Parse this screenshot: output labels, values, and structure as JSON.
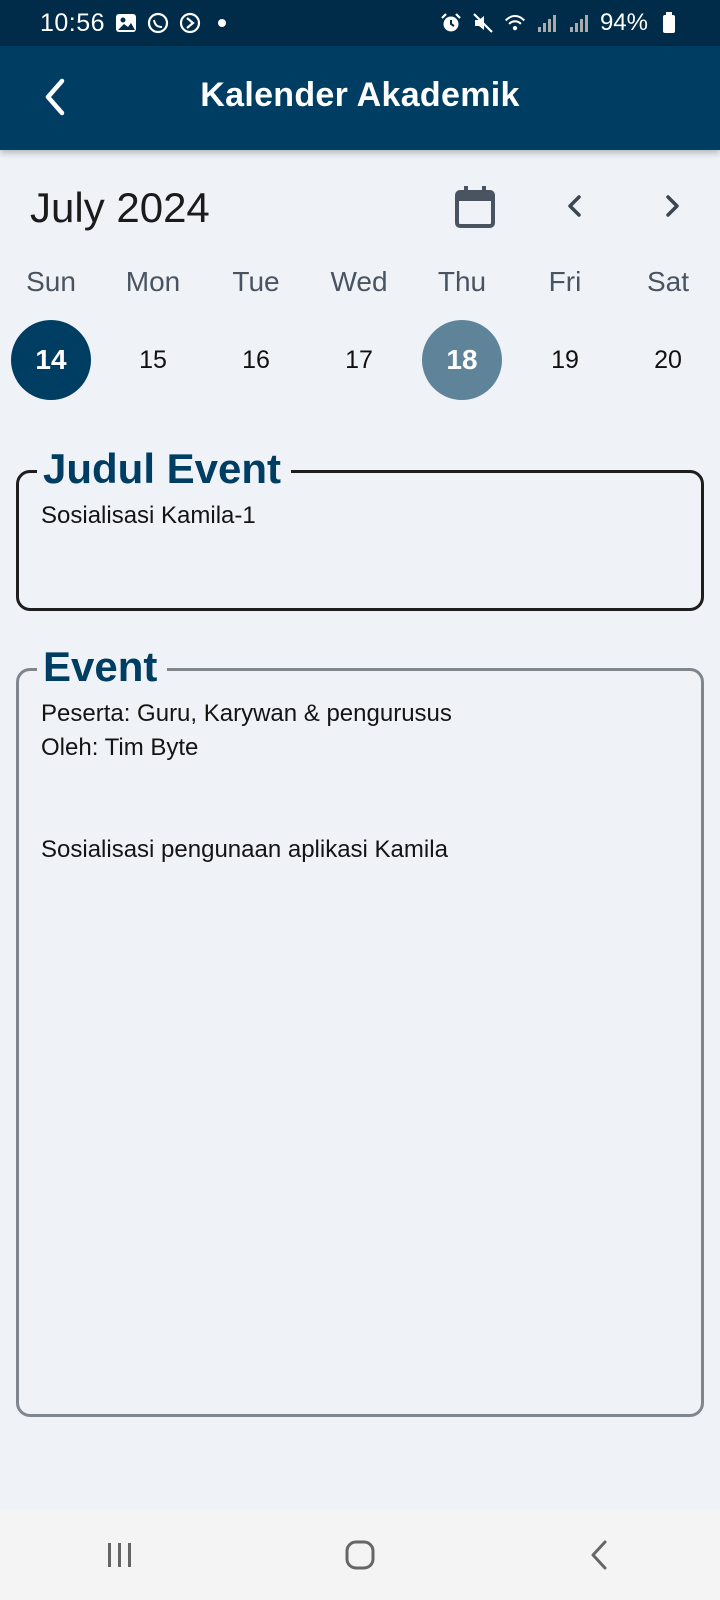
{
  "status_bar": {
    "time": "10:56",
    "battery": "94%",
    "icons_left": [
      "gallery-icon",
      "whatsapp-icon",
      "app-icon",
      "dot-icon"
    ],
    "icons_right": [
      "alarm-icon",
      "mute-icon",
      "wifi-icon",
      "signal-icon",
      "signal-icon",
      "battery-icon"
    ]
  },
  "app_bar": {
    "title": "Kalender Akademik",
    "back_icon": "chevron-left-icon"
  },
  "calendar": {
    "month_label": "July 2024",
    "week": [
      {
        "day": "Sun",
        "date": "14",
        "state": "selected"
      },
      {
        "day": "Mon",
        "date": "15",
        "state": "normal"
      },
      {
        "day": "Tue",
        "date": "16",
        "state": "normal"
      },
      {
        "day": "Wed",
        "date": "17",
        "state": "normal"
      },
      {
        "day": "Thu",
        "date": "18",
        "state": "marked"
      },
      {
        "day": "Fri",
        "date": "19",
        "state": "normal"
      },
      {
        "day": "Sat",
        "date": "20",
        "state": "normal"
      }
    ],
    "colors": {
      "selected": "#003d62",
      "marked": "#5f8499"
    }
  },
  "event_title_box": {
    "legend": "Judul Event",
    "value": "Sosialisasi Kamila-1"
  },
  "event_box": {
    "legend": "Event",
    "value": "Peserta: Guru, Karywan & pengurusus\nOleh: Tim Byte\n\n\nSosialisasi pengunaan aplikasi Kamila"
  },
  "nav_bar": {
    "icons": [
      "recent-apps-icon",
      "home-icon",
      "back-icon"
    ]
  },
  "theme": {
    "primary": "#003d62",
    "status_bar": "#002b49",
    "background": "#eff3f8"
  }
}
